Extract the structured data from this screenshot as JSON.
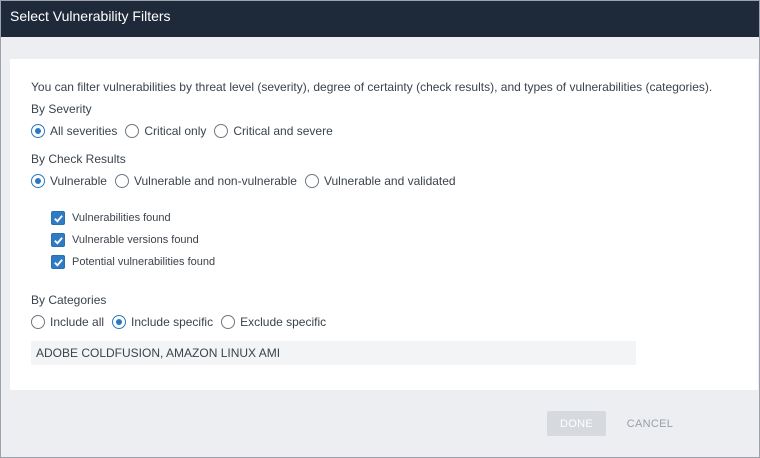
{
  "dialog": {
    "title": "Select Vulnerability Filters",
    "description": "You can filter vulnerabilities by threat level (severity), degree of certainty (check results), and types of vulnerabilities (categories)."
  },
  "severity": {
    "heading": "By Severity",
    "options": [
      "All severities",
      "Critical only",
      "Critical and severe"
    ],
    "selected": "All severities"
  },
  "check_results": {
    "heading": "By Check Results",
    "options": [
      "Vulnerable",
      "Vulnerable and non-vulnerable",
      "Vulnerable and validated"
    ],
    "selected": "Vulnerable",
    "checkboxes": [
      {
        "label": "Vulnerabilities found",
        "checked": true
      },
      {
        "label": "Vulnerable versions found",
        "checked": true
      },
      {
        "label": "Potential vulnerabilities found",
        "checked": true
      }
    ]
  },
  "categories": {
    "heading": "By Categories",
    "options": [
      "Include all",
      "Include specific",
      "Exclude specific"
    ],
    "selected": "Include specific",
    "value": "ADOBE COLDFUSION, AMAZON LINUX AMI"
  },
  "footer": {
    "done_label": "DONE",
    "cancel_label": "CANCEL"
  },
  "colors": {
    "titlebar": "#1e2a3a",
    "accent": "#2b78c2"
  }
}
